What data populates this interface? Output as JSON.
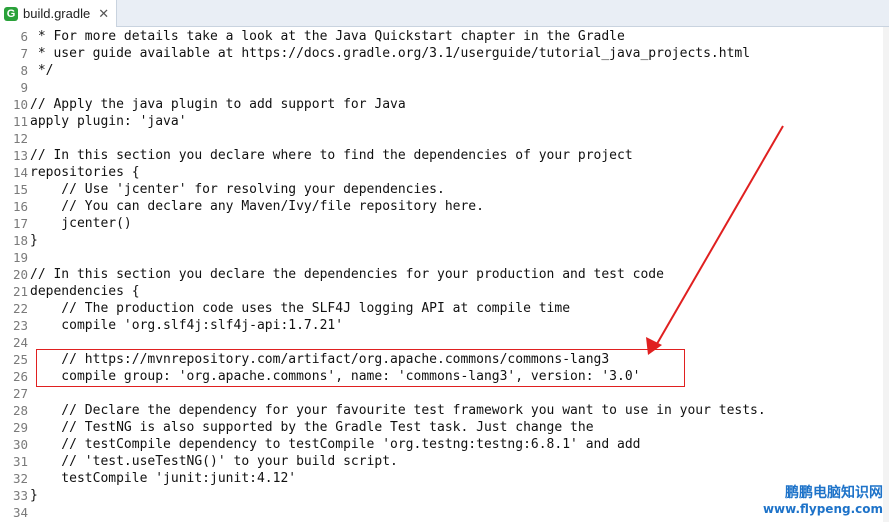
{
  "tab": {
    "icon": "gradle-icon",
    "title": "build.gradle",
    "close": "✕"
  },
  "lines": [
    {
      "n": "6",
      "text": " * For more details take a look at the Java Quickstart chapter in the Gradle"
    },
    {
      "n": "7",
      "text": " * user guide available at https://docs.gradle.org/3.1/userguide/tutorial_java_projects.html"
    },
    {
      "n": "8",
      "text": " */"
    },
    {
      "n": "9",
      "text": ""
    },
    {
      "n": "10",
      "text": "// Apply the java plugin to add support for Java"
    },
    {
      "n": "11",
      "text": "apply plugin: 'java'"
    },
    {
      "n": "12",
      "text": ""
    },
    {
      "n": "13",
      "text": "// In this section you declare where to find the dependencies of your project"
    },
    {
      "n": "14",
      "text": "repositories {"
    },
    {
      "n": "15",
      "text": "    // Use 'jcenter' for resolving your dependencies."
    },
    {
      "n": "16",
      "text": "    // You can declare any Maven/Ivy/file repository here."
    },
    {
      "n": "17",
      "text": "    jcenter()"
    },
    {
      "n": "18",
      "text": "}"
    },
    {
      "n": "19",
      "text": ""
    },
    {
      "n": "20",
      "text": "// In this section you declare the dependencies for your production and test code"
    },
    {
      "n": "21",
      "text": "dependencies {"
    },
    {
      "n": "22",
      "text": "    // The production code uses the SLF4J logging API at compile time"
    },
    {
      "n": "23",
      "text": "    compile 'org.slf4j:slf4j-api:1.7.21'"
    },
    {
      "n": "24",
      "text": ""
    },
    {
      "n": "25",
      "text": "    // https://mvnrepository.com/artifact/org.apache.commons/commons-lang3"
    },
    {
      "n": "26",
      "text": "    compile group: 'org.apache.commons', name: 'commons-lang3', version: '3.0'"
    },
    {
      "n": "27",
      "text": ""
    },
    {
      "n": "28",
      "text": "    // Declare the dependency for your favourite test framework you want to use in your tests."
    },
    {
      "n": "29",
      "text": "    // TestNG is also supported by the Gradle Test task. Just change the"
    },
    {
      "n": "30",
      "text": "    // testCompile dependency to testCompile 'org.testng:testng:6.8.1' and add"
    },
    {
      "n": "31",
      "text": "    // 'test.useTestNG()' to your build script."
    },
    {
      "n": "32",
      "text": "    testCompile 'junit:junit:4.12'"
    },
    {
      "n": "33",
      "text": "}"
    },
    {
      "n": "34",
      "text": ""
    }
  ],
  "watermark": {
    "title": "鹏鹏电脑知识网",
    "url": "www.flypeng.com"
  },
  "colors": {
    "highlight": "#e02020",
    "gradle_green": "#2aa13a",
    "watermark": "#1e73c9"
  }
}
